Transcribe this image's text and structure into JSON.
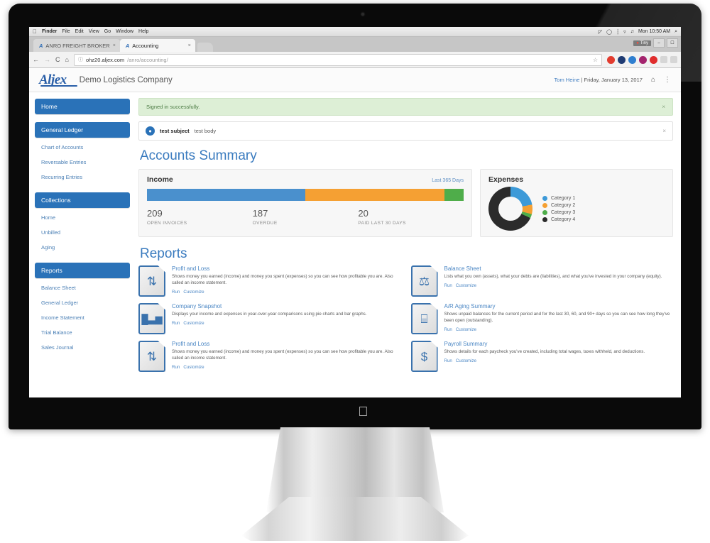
{
  "os_bar": {
    "apple": "",
    "items": [
      "Finder",
      "File",
      "Edit",
      "View",
      "Go",
      "Window",
      "Help"
    ],
    "clock": "Mon 10:50 AM",
    "status_icons": [
      "time-machine-icon",
      "speech-bubble-icon",
      "battery-icon",
      "wifi-icon",
      "volume-icon"
    ],
    "search": "search-icon"
  },
  "browser": {
    "tabs": [
      {
        "label": "ANRO FREIGHT BROKER",
        "favicon": "A",
        "active": false,
        "close": "×"
      },
      {
        "label": "Accounting",
        "favicon": "A",
        "active": true,
        "close": "×"
      }
    ],
    "window_controls": {
      "record_label": "Tiny",
      "minimize": "–",
      "maximize": "⬜"
    },
    "nav": {
      "back": "←",
      "forward": "→",
      "reload": "C",
      "home": "⌂"
    },
    "omnibox": {
      "info_icon": "ⓘ",
      "url_domain": "ohz20.aljex.com",
      "url_path": "/anro/accounting/",
      "star": "☆"
    },
    "extension_colors": [
      "#e23b2e",
      "#1f3b73",
      "#2f7fd0",
      "#a4246e",
      "#e02d2d"
    ]
  },
  "app": {
    "logo": "Aljex",
    "company": "Demo Logistics Company",
    "user": "Tom Heine",
    "separator": "|",
    "date": "Friday, January 13, 2017",
    "home_icon": "⌂",
    "menu_icon": "⋮"
  },
  "sidebar": {
    "groups": [
      {
        "header": "Home",
        "links": []
      },
      {
        "header": "General Ledger",
        "links": [
          "Chart of Accounts",
          "Reversable Entries",
          "Recurring Entries"
        ]
      },
      {
        "header": "Collections",
        "links": [
          "Home",
          "Unbilled",
          "Aging"
        ]
      },
      {
        "header": "Reports",
        "links": [
          "Balance Sheet",
          "General Ledger",
          "Income Statement",
          "Trial Balance",
          "Sales Journal"
        ]
      }
    ]
  },
  "alerts": {
    "success": {
      "text": "Signed in successfully.",
      "close": "×"
    },
    "notice": {
      "icon": "bell-icon",
      "subject": "test subject",
      "body": "test body",
      "close": "×"
    }
  },
  "main": {
    "page_title": "Accounts Summary",
    "reports_title": "Reports"
  },
  "income_card": {
    "title": "Income",
    "range": "Last 365 Days",
    "stats": [
      {
        "value": "209",
        "label": "OPEN INVOICES"
      },
      {
        "value": "187",
        "label": "OVERDUE"
      },
      {
        "value": "20",
        "label": "PAID LAST 30 DAYS"
      }
    ]
  },
  "expenses_card": {
    "title": "Expenses",
    "legend": [
      "Category 1",
      "Category 2",
      "Category 3",
      "Category 4"
    ]
  },
  "chart_data": [
    {
      "type": "bar",
      "title": "Income",
      "subtitle": "Last 365 Days",
      "orientation": "horizontal-stacked",
      "categories": [
        "Open Invoices",
        "Overdue",
        "Paid Last 30 Days"
      ],
      "values": [
        50,
        44,
        6
      ],
      "value_unit": "percent",
      "counts": [
        209,
        187,
        20
      ],
      "colors": [
        "#4a90cd",
        "#f5a033",
        "#4fad4a"
      ],
      "grid": false,
      "legend": "none"
    },
    {
      "type": "pie",
      "variant": "donut",
      "title": "Expenses",
      "labels": [
        "Category 1",
        "Category 2",
        "Category 3",
        "Category 4"
      ],
      "values": [
        22,
        7,
        3,
        68
      ],
      "value_unit": "percent",
      "colors": [
        "#3d9ad8",
        "#f5a033",
        "#4fad4a",
        "#2b2b2b"
      ],
      "legend": "right"
    }
  ],
  "reports": [
    {
      "icon": "updown-arrows-icon",
      "glyph": "⇅",
      "title": "Profit and Loss",
      "description": "Shows money you earned (income) and money you spent (expenses) so you can see how profitable you are. Also called an income statement.",
      "actions": [
        "Run",
        "Customize"
      ]
    },
    {
      "icon": "scales-icon",
      "glyph": "⚖",
      "title": "Balance Sheet",
      "description": "Lists what you own (assets), what your debts are (liabilities), and what you've invested in your company (equity).",
      "actions": [
        "Run",
        "Customize"
      ]
    },
    {
      "icon": "bar-chart-icon",
      "glyph": "█▃▆",
      "title": "Company Snapshot",
      "description": "Displays your income and expenses in year-over-year comparisons using pie charts and bar graphs.",
      "actions": [
        "Run",
        "Customize"
      ]
    },
    {
      "icon": "calculator-icon",
      "glyph": "⌸",
      "title": "A/R Aging Summary",
      "description": "Shows unpaid balances for the current period and for the last 30, 60, and 90+ days so you can see how long they've been open (outstanding).",
      "actions": [
        "Run",
        "Customize"
      ]
    },
    {
      "icon": "updown-arrows-icon",
      "glyph": "⇅",
      "title": "Profit and Loss",
      "description": "Shows money you earned (income) and money you spent (expenses) so you can see how profitable you are. Also called an income statement.",
      "actions": [
        "Run",
        "Customize"
      ]
    },
    {
      "icon": "money-hand-icon",
      "glyph": "$",
      "title": "Payroll Summary",
      "description": "Shows details for each paycheck you've created, including total wages, taxes withheld, and deductions.",
      "actions": [
        "Run",
        "Customize"
      ]
    }
  ],
  "colors": {
    "brand_blue": "#2a72b8",
    "title_blue": "#3a7bbf",
    "link_blue": "#4a86c4",
    "success_bg": "#ddefd6",
    "income_blue": "#4a90cd",
    "income_orange": "#f5a033",
    "income_green": "#4fad4a",
    "expense_dark": "#2b2b2b"
  }
}
